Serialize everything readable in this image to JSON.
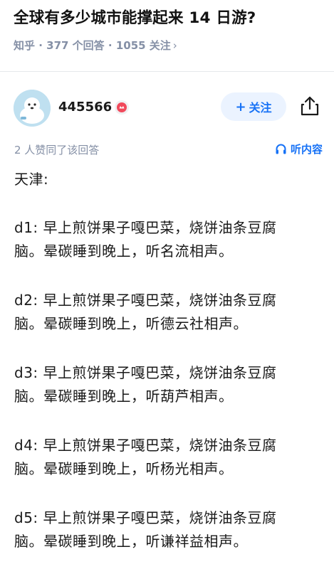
{
  "question": {
    "title": "全球有多少城市能撑起来 14 日游?",
    "meta": "知乎 · 377 个回答 · 1055 关注",
    "meta_chevron": "›"
  },
  "author": {
    "name": "445566",
    "follow_label": "关注",
    "follow_plus": "+"
  },
  "answer": {
    "likes_text": "2 人赞同了该回答",
    "listen_label": "听内容",
    "city": "天津:",
    "days": [
      {
        "label": "d1:",
        "text": "早上煎饼果子嘎巴菜，烧饼油条豆腐",
        "text2": "脑。晕碳睡到晚上，听名流相声。"
      },
      {
        "label": "d2:",
        "text": "早上煎饼果子嘎巴菜，烧饼油条豆腐",
        "text2": "脑。晕碳睡到晚上，听德云社相声。"
      },
      {
        "label": "d3:",
        "text": "早上煎饼果子嘎巴菜，烧饼油条豆腐",
        "text2": "脑。晕碳睡到晚上，听葫芦相声。"
      },
      {
        "label": "d4:",
        "text": "早上煎饼果子嘎巴菜，烧饼油条豆腐",
        "text2": "脑。晕碳睡到晚上，听杨光相声。"
      },
      {
        "label": "d5:",
        "text": "早上煎饼果子嘎巴菜，烧饼油条豆腐",
        "text2": "脑。晕碳睡到晚上，听谦祥益相声。"
      }
    ]
  },
  "icons": {
    "share": "share-icon",
    "headphones": "headphones-icon",
    "badge": "badge-icon"
  },
  "colors": {
    "accent": "#1772f6",
    "muted": "#8590a6",
    "follow_bg": "#ebf3ff"
  }
}
